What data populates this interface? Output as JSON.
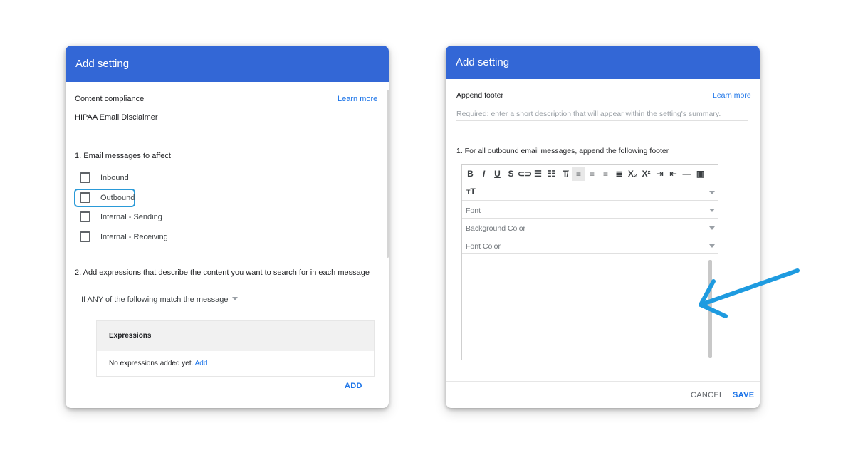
{
  "left_dialog": {
    "title": "Add setting",
    "setting_name": "Content compliance",
    "learn_more": "Learn more",
    "description_value": "HIPAA Email Disclaimer",
    "section1": "1. Email messages to affect",
    "checkboxes": [
      {
        "label": "Inbound",
        "checked": false
      },
      {
        "label": "Outbound",
        "checked": false,
        "focused": true
      },
      {
        "label": "Internal - Sending",
        "checked": false
      },
      {
        "label": "Internal - Receiving",
        "checked": false
      }
    ],
    "section2": "2. Add expressions that describe the content you want to search for in each message",
    "match_select": "If ANY of the following match the message",
    "expressions_header": "Expressions",
    "no_expressions": "No expressions added yet.",
    "add_link": "Add",
    "add_button": "ADD"
  },
  "right_dialog": {
    "title": "Add setting",
    "setting_name": "Append footer",
    "learn_more": "Learn more",
    "description_placeholder": "Required: enter a short description that will appear within the setting's summary.",
    "section1": "1. For all outbound email messages, append the following footer",
    "toolbar_icons": [
      "bold-icon",
      "italic-icon",
      "underline-icon",
      "strikethrough-icon",
      "link-icon",
      "numbered-list-icon",
      "bulleted-list-icon",
      "clear-format-icon",
      "align-left-icon",
      "align-center-icon",
      "align-right-icon",
      "justify-icon",
      "subscript-icon",
      "superscript-icon",
      "indent-icon",
      "outdent-icon",
      "horizontal-rule-icon",
      "image-icon"
    ],
    "text_size_icon": "text-size-icon",
    "font_select": "Font",
    "bg_color_select": "Background Color",
    "font_color_select": "Font Color",
    "cancel_button": "CANCEL",
    "save_button": "SAVE"
  },
  "colors": {
    "header": "#3367d6",
    "accent": "#1a73e8",
    "arrow": "#1e9be0",
    "focus": "#2a9ad8"
  }
}
